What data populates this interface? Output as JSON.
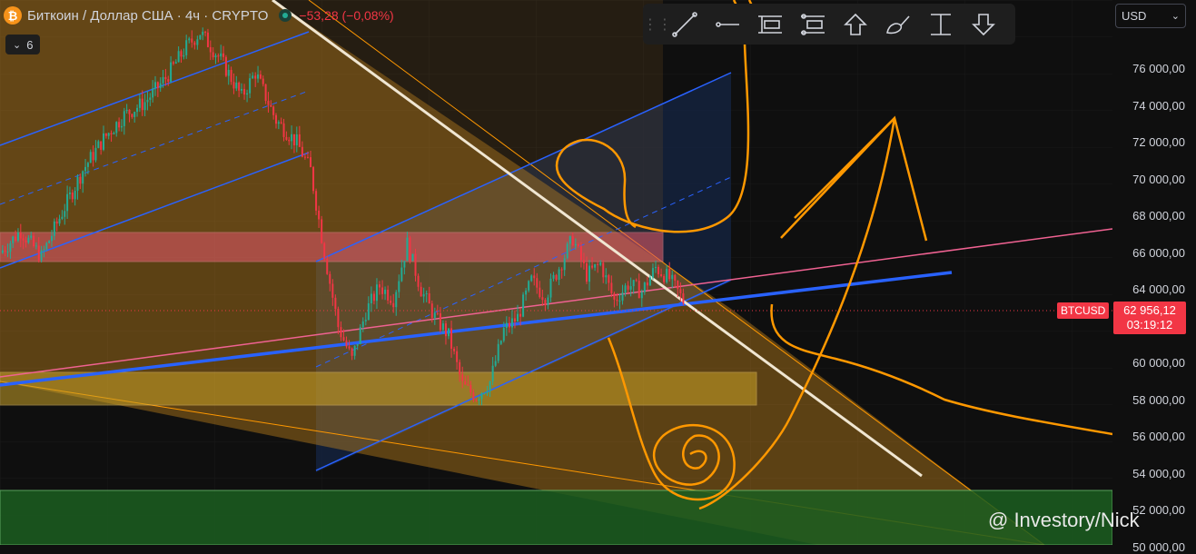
{
  "header": {
    "logo_glyph": "₿",
    "title": "Биткоин / Доллар США · 4ч · CRYPTO",
    "change": "−53,28 (−0,08%)"
  },
  "indicator_toggle": {
    "count": "6",
    "icon": "chevron-down-icon"
  },
  "toolbar": {
    "grip_icon": "drag-grip-icon",
    "tools": [
      "trend-line-icon",
      "horizontal-ray-icon",
      "price-label-icon",
      "price-range-s-icon",
      "arrow-up-icon",
      "brush-icon",
      "measure-icon",
      "arrow-down-icon"
    ]
  },
  "currency": {
    "value": "USD",
    "icon": "chevron-down-icon"
  },
  "price_axis": {
    "labels": [
      "76 000,00",
      "74 000,00",
      "72 000,00",
      "70 000,00",
      "68 000,00",
      "66 000,00",
      "64 000,00",
      "60 000,00",
      "58 000,00",
      "56 000,00",
      "54 000,00",
      "52 000,00",
      "50 000,00"
    ]
  },
  "last_price": {
    "symbol": "BTCUSD",
    "price": "62 956,12",
    "countdown": "03:19:12"
  },
  "watermark": {
    "text": "@ Investory/Nick"
  },
  "colors": {
    "background": "#0f0f0f",
    "up": "#22ab94",
    "down": "#f23645",
    "wedge_fill": "#c8891c",
    "channel_line": "#2962ff",
    "pink_line": "#f06292",
    "drawing_orange": "#ff9800",
    "support_zone": "#1b5e20"
  },
  "chart_data": {
    "type": "candlestick",
    "symbol": "BTCUSD",
    "interval": "4h",
    "ylim": [
      50000,
      78000
    ],
    "y_ticks": [
      76000,
      74000,
      72000,
      70000,
      68000,
      66000,
      64000,
      60000,
      58000,
      56000,
      54000,
      52000,
      50000
    ],
    "last_price": 62956.12,
    "price_path": [
      [
        0,
        66000
      ],
      [
        3,
        67200
      ],
      [
        6,
        65800
      ],
      [
        9,
        68200
      ],
      [
        12,
        70500
      ],
      [
        15,
        72200
      ],
      [
        18,
        73500
      ],
      [
        21,
        74200
      ],
      [
        24,
        75500
      ],
      [
        27,
        77200
      ],
      [
        29,
        78000
      ],
      [
        32,
        76500
      ],
      [
        35,
        74500
      ],
      [
        37,
        75800
      ],
      [
        40,
        73200
      ],
      [
        43,
        72000
      ],
      [
        45,
        70500
      ],
      [
        47,
        66000
      ],
      [
        49,
        62000
      ],
      [
        51,
        60200
      ],
      [
        53,
        62800
      ],
      [
        55,
        64200
      ],
      [
        57,
        63500
      ],
      [
        59,
        66500
      ],
      [
        61,
        64000
      ],
      [
        63,
        62500
      ],
      [
        65,
        61500
      ],
      [
        67,
        58800
      ],
      [
        69,
        58200
      ],
      [
        71,
        59000
      ],
      [
        73,
        61800
      ],
      [
        75,
        62500
      ],
      [
        77,
        64500
      ],
      [
        79,
        63600
      ],
      [
        81,
        65200
      ],
      [
        83,
        66800
      ],
      [
        85,
        64800
      ],
      [
        87,
        65400
      ],
      [
        89,
        63400
      ],
      [
        91,
        64300
      ],
      [
        93,
        63900
      ],
      [
        95,
        65200
      ],
      [
        97,
        64600
      ],
      [
        99,
        63400
      ]
    ],
    "zones": [
      {
        "kind": "resistance",
        "y_top": 67200,
        "y_bottom": 65600
      },
      {
        "kind": "demand",
        "y_top": 59500,
        "y_bottom": 57800
      },
      {
        "kind": "support",
        "y_top": 53000,
        "y_bottom": 50000
      }
    ]
  }
}
